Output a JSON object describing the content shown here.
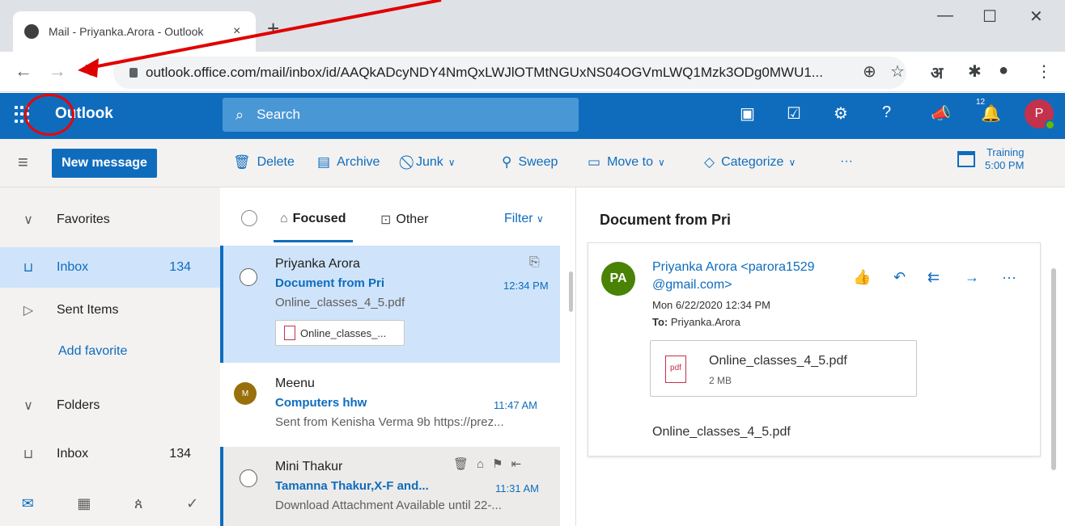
{
  "browser": {
    "tab_title": "Mail - Priyanka.Arora - Outlook",
    "tab_close": "×",
    "new_tab": "+",
    "url": "outlook.office.com/mail/inbox/id/AAQkADcyNDY4NmQxLWJlOTMtNGUxNS04OGVmLWQ1Mzk3ODg0MWU1...",
    "lang_icon": "अ"
  },
  "header": {
    "app_name": "Outlook",
    "search_placeholder": "Search",
    "notif_badge": "12",
    "avatar_initial": "P"
  },
  "commands": {
    "new_message": "New message",
    "delete": "Delete",
    "archive": "Archive",
    "junk": "Junk",
    "sweep": "Sweep",
    "move_to": "Move to",
    "categorize": "Categorize",
    "more": "···",
    "event_title": "Training",
    "event_time": "5:00 PM"
  },
  "nav": {
    "favorites": "Favorites",
    "inbox": "Inbox",
    "inbox_count": "134",
    "sent": "Sent Items",
    "add_favorite": "Add favorite",
    "folders": "Folders",
    "folder_inbox": "Inbox",
    "folder_inbox_count": "134"
  },
  "list": {
    "focused": "Focused",
    "other": "Other",
    "filter": "Filter",
    "messages": [
      {
        "sender": "Priyanka Arora",
        "subject": "Document from Pri",
        "time": "12:34 PM",
        "preview": "Online_classes_4_5.pdf",
        "attachment": "Online_classes_..."
      },
      {
        "avatar": "M",
        "sender": "Meenu",
        "subject": "Computers hhw",
        "time": "11:47 AM",
        "preview": "Sent from Kenisha Verma 9b https://prez..."
      },
      {
        "sender": "Mini Thakur",
        "subject": "Tamanna Thakur,X-F and...",
        "time": "11:31 AM",
        "preview": "Download Attachment Available until 22-..."
      }
    ]
  },
  "reading": {
    "title": "Document from Pri",
    "avatar": "PA",
    "sender_line1": "Priyanka Arora <parora1529",
    "sender_line2": "@gmail.com>",
    "date": "Mon 6/22/2020 12:34 PM",
    "to_label": "To:",
    "to": "Priyanka.Arora",
    "attachment_name": "Online_classes_4_5.pdf",
    "attachment_size": "2 MB",
    "pdf_label": "pdf",
    "body": "Online_classes_4_5.pdf"
  },
  "colors": {
    "outlook_blue": "#0f6cbd",
    "selected_bg": "#cfe4fa",
    "annotation_red": "#e00000"
  }
}
